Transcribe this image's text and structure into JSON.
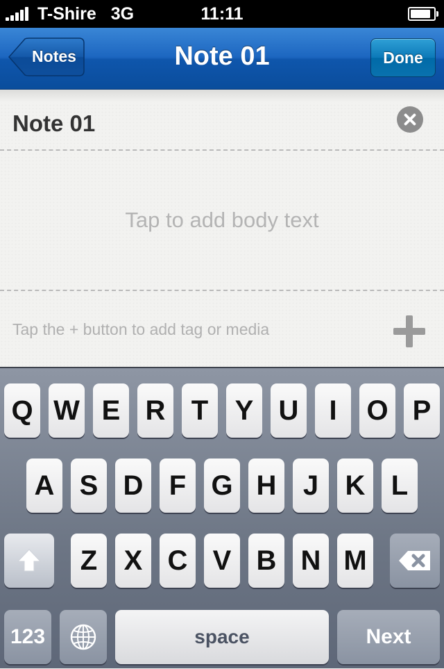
{
  "status_bar": {
    "carrier": "T-Shire",
    "network": "3G",
    "time": "11:11"
  },
  "nav": {
    "back_label": "Notes",
    "title": "Note 01",
    "done_label": "Done"
  },
  "note": {
    "title": "Note 01",
    "body_placeholder": "Tap to add body text",
    "tag_hint": "Tap the + button to add tag or media"
  },
  "keyboard": {
    "row1": [
      "Q",
      "W",
      "E",
      "R",
      "T",
      "Y",
      "U",
      "I",
      "O",
      "P"
    ],
    "row2": [
      "A",
      "S",
      "D",
      "F",
      "G",
      "H",
      "J",
      "K",
      "L"
    ],
    "row3": [
      "Z",
      "X",
      "C",
      "V",
      "B",
      "N",
      "M"
    ],
    "numbers_label": "123",
    "space_label": "space",
    "next_label": "Next"
  },
  "icons": {
    "back": "back-arrow-button",
    "clear": "clear-icon",
    "add": "plus-icon",
    "shift": "shift-icon",
    "delete": "backspace-icon",
    "globe": "globe-icon"
  },
  "colors": {
    "nav_blue": "#1c66c0",
    "done_blue": "#0c79b8"
  }
}
